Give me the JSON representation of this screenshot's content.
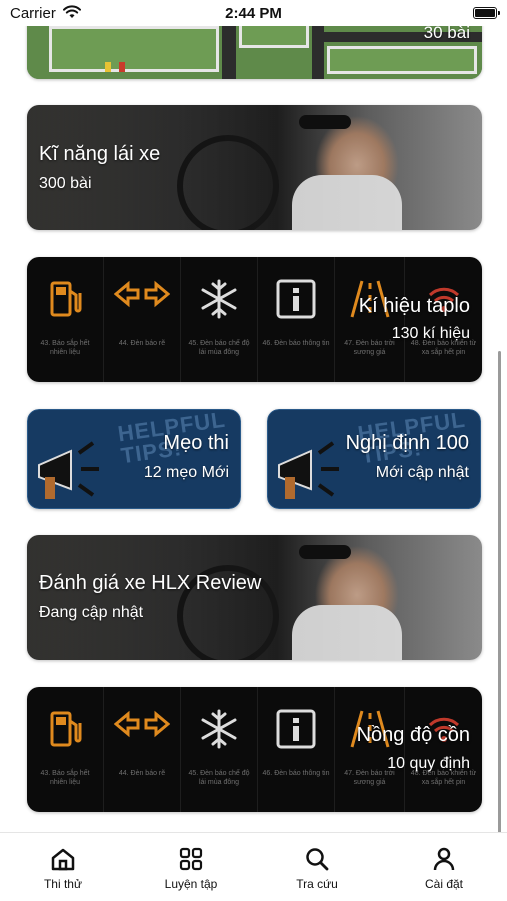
{
  "status_bar": {
    "carrier": "Carrier",
    "time": "2:44 PM"
  },
  "cards": {
    "map_count": "30 bài",
    "driving_skill": {
      "title": "Kĩ năng lái xe",
      "subtitle": "300 bài"
    },
    "dashboard_symbols": {
      "title": "Kí hiệu taplo",
      "subtitle": "130 kí hiệu",
      "captions": [
        "43. Báo sắp hết nhiên liệu",
        "44. Đèn báo rẽ",
        "45. Đèn báo chế độ lái mùa đông",
        "46. Đèn báo thông tin",
        "47. Đèn báo trời sương giá",
        "48. Đèn báo khiển từ xa sắp hết pin"
      ]
    },
    "exam_tips": {
      "title": "Mẹo thi",
      "subtitle": "12 mẹo Mới",
      "art": "HELPFUL TIPS!"
    },
    "decree_100": {
      "title": "Nghị định 100",
      "subtitle": "Mới cập nhật",
      "art": "HELPFUL TIPS!"
    },
    "car_review": {
      "title": "Đánh giá xe HLX Review",
      "subtitle": "Đang cập nhật"
    },
    "alcohol": {
      "title": "Nồng độ cồn",
      "subtitle": "10 quy định",
      "captions": [
        "43. Báo sắp hết nhiên liệu",
        "44. Đèn báo rẽ",
        "45. Đèn báo chế độ lái mùa đông",
        "46. Đèn báo thông tin",
        "47. Đèn báo trời sương giá",
        "48. Đèn báo khiển từ xa sắp hết pin"
      ]
    }
  },
  "tabs": [
    {
      "label": "Thi thử",
      "icon": "home-icon"
    },
    {
      "label": "Luyện tập",
      "icon": "grid-icon"
    },
    {
      "label": "Tra cứu",
      "icon": "search-icon"
    },
    {
      "label": "Cài đặt",
      "icon": "person-icon"
    }
  ],
  "colors": {
    "dash_icon": "#e08a1e",
    "tips_bg": "#163a62",
    "warning_red": "#c0392b"
  }
}
